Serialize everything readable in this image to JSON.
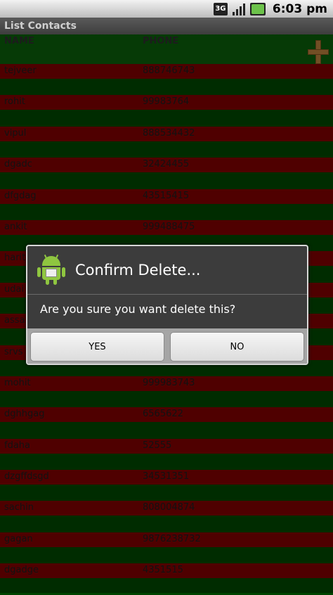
{
  "status_bar": {
    "network_label": "3G",
    "time": "6:03 pm"
  },
  "app": {
    "title": "List Contacts"
  },
  "header": {
    "name_label": "NAME",
    "phone_label": "PHONE",
    "add_icon": "plus-icon"
  },
  "contacts": [
    {
      "name": "tejveer",
      "phone": "888746743"
    },
    {
      "name": "rohit",
      "phone": "99983764"
    },
    {
      "name": "vipul",
      "phone": "888534432"
    },
    {
      "name": "dgadc",
      "phone": "32424455"
    },
    {
      "name": "dfgdag",
      "phone": "43515415"
    },
    {
      "name": "ankit",
      "phone": "999488475"
    },
    {
      "name": "harit",
      "phone": ""
    },
    {
      "name": "udai",
      "phone": ""
    },
    {
      "name": "assa",
      "phone": ""
    },
    {
      "name": "srvs",
      "phone": ""
    },
    {
      "name": "mohit",
      "phone": "999983743"
    },
    {
      "name": "dghhgag",
      "phone": "6565622"
    },
    {
      "name": "fdaha",
      "phone": "52555"
    },
    {
      "name": "dzgffdsgd",
      "phone": "34531351"
    },
    {
      "name": "sachin",
      "phone": "808004874"
    },
    {
      "name": "gagan",
      "phone": "9876238732"
    },
    {
      "name": "dgadge",
      "phone": "4351515"
    }
  ],
  "dialog": {
    "icon": "android-icon",
    "title": "Confirm Delete...",
    "message": "Are you sure you want delete this?",
    "yes_label": "YES",
    "no_label": "NO"
  },
  "colors": {
    "row_red": "#7a0000",
    "row_green": "#004400",
    "icon_plus": "#b07a3a",
    "android_green": "#8fc640"
  }
}
